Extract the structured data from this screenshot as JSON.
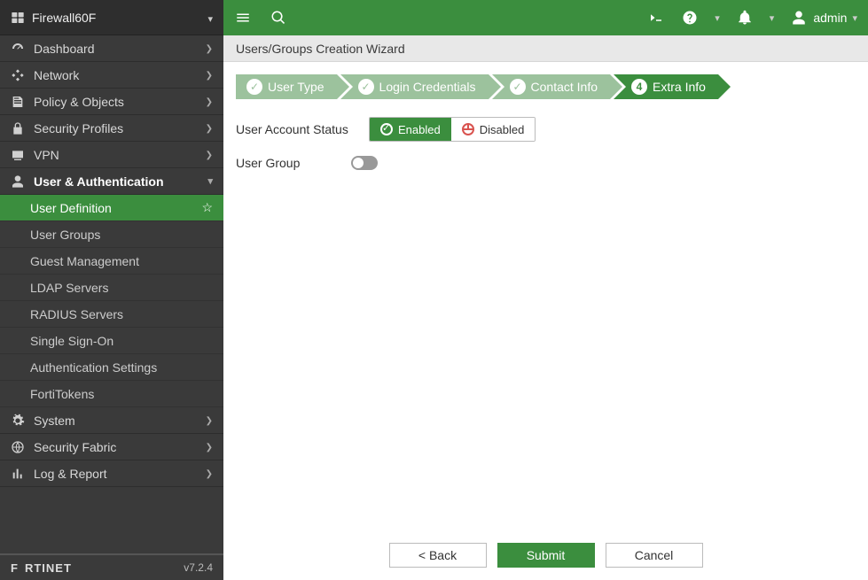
{
  "hostname": "Firewall60F",
  "version": "v7.2.4",
  "brand": "FORTINET",
  "topbar": {
    "user_label": "admin"
  },
  "sidebar": {
    "items": [
      {
        "label": "Dashboard"
      },
      {
        "label": "Network"
      },
      {
        "label": "Policy & Objects"
      },
      {
        "label": "Security Profiles"
      },
      {
        "label": "VPN"
      },
      {
        "label": "User & Authentication"
      },
      {
        "label": "System"
      },
      {
        "label": "Security Fabric"
      },
      {
        "label": "Log & Report"
      }
    ],
    "userauth_children": [
      {
        "label": "User Definition"
      },
      {
        "label": "User Groups"
      },
      {
        "label": "Guest Management"
      },
      {
        "label": "LDAP Servers"
      },
      {
        "label": "RADIUS Servers"
      },
      {
        "label": "Single Sign-On"
      },
      {
        "label": "Authentication Settings"
      },
      {
        "label": "FortiTokens"
      }
    ]
  },
  "page": {
    "title": "Users/Groups Creation Wizard",
    "steps": [
      {
        "label": "User Type"
      },
      {
        "label": "Login Credentials"
      },
      {
        "label": "Contact Info"
      },
      {
        "label": "Extra Info",
        "num": "4"
      }
    ],
    "form": {
      "status_label": "User Account Status",
      "enabled": "Enabled",
      "disabled": "Disabled",
      "group_label": "User Group"
    },
    "buttons": {
      "back": "< Back",
      "submit": "Submit",
      "cancel": "Cancel"
    }
  }
}
